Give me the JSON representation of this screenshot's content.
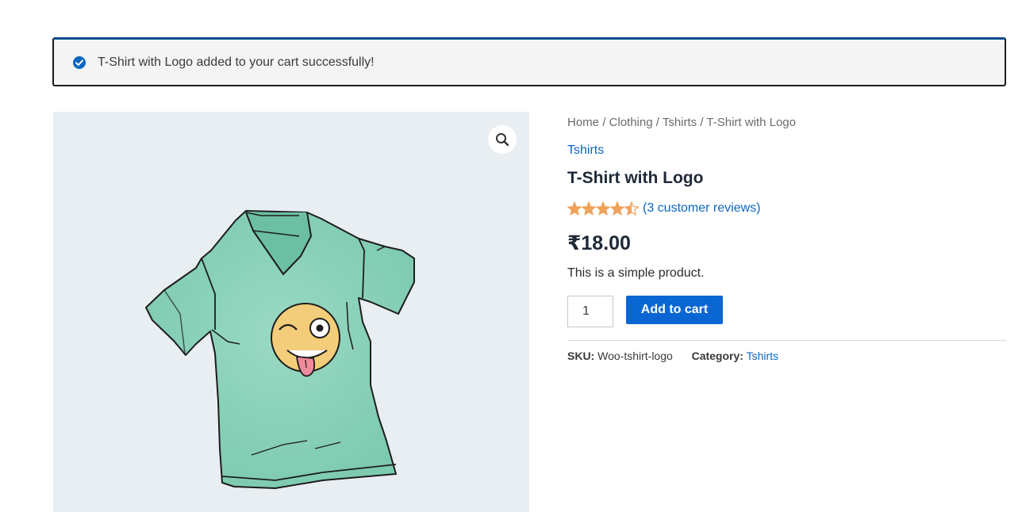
{
  "notice": {
    "message": "T-Shirt with Logo added to your cart successfully!",
    "icon": "check-circle-icon",
    "accent_color": "#0a66c2"
  },
  "gallery": {
    "zoom_icon": "magnifier-icon",
    "image_description_name": "tshirt-image"
  },
  "breadcrumb": {
    "items": [
      "Home",
      "Clothing",
      "Tshirts",
      "T-Shirt with Logo"
    ],
    "separator": "/"
  },
  "product": {
    "category_link": "Tshirts",
    "title": "T-Shirt with Logo",
    "rating": 4.5,
    "rating_max": 5,
    "star_color": "#f0a25a",
    "reviews_label": "(3 customer reviews)",
    "price": "₹18.00",
    "short_description": "This is a simple product.",
    "quantity": "1",
    "add_to_cart_label": "Add to cart",
    "button_color": "#0a66d2",
    "sku_label": "SKU:",
    "sku_value": "Woo-tshirt-logo",
    "category_label": "Category:",
    "category_value": "Tshirts"
  }
}
